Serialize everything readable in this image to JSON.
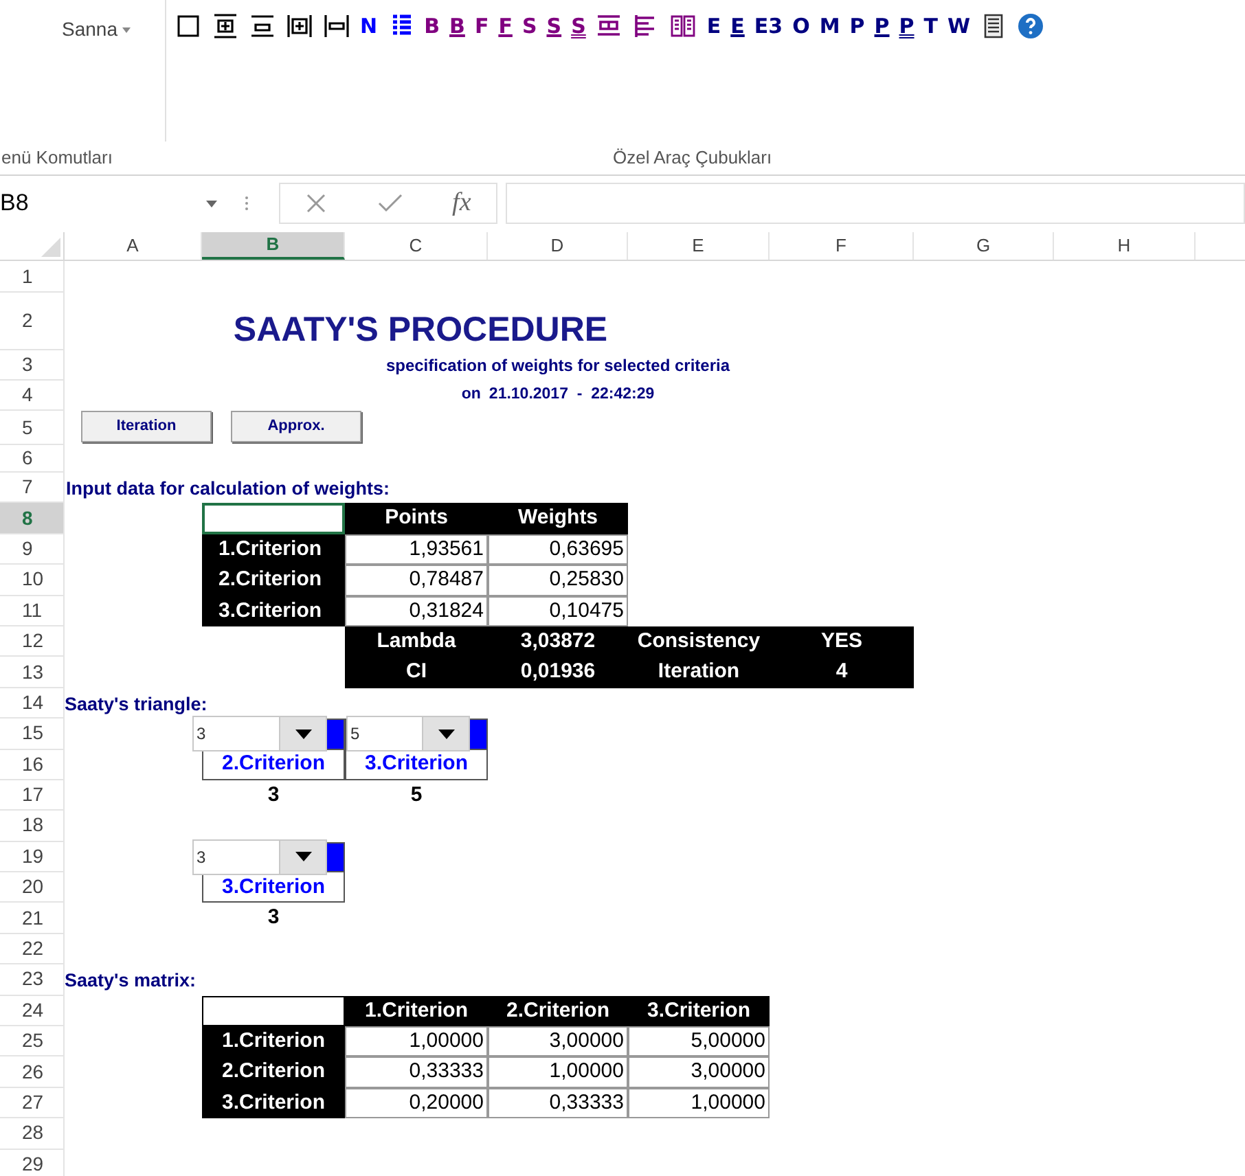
{
  "ribbon": {
    "font_box": "Sanna",
    "toolbar": [
      {
        "kind": "square"
      },
      {
        "kind": "insert-row"
      },
      {
        "kind": "lines"
      },
      {
        "kind": "plus-column"
      },
      {
        "kind": "minus-column"
      },
      {
        "kind": "letter",
        "text": "N",
        "color": "#0000ff"
      },
      {
        "kind": "list"
      },
      {
        "kind": "letter",
        "text": "B",
        "color": "#800080"
      },
      {
        "kind": "underlined",
        "text": "B",
        "color": "#800080"
      },
      {
        "kind": "letter",
        "text": "F",
        "color": "#800080"
      },
      {
        "kind": "underlined",
        "text": "F",
        "color": "#800080"
      },
      {
        "kind": "letter",
        "text": "S",
        "color": "#800080"
      },
      {
        "kind": "underlined",
        "text": "S",
        "color": "#800080"
      },
      {
        "kind": "double",
        "text": "S",
        "color": "#800080"
      },
      {
        "kind": "table"
      },
      {
        "kind": "align"
      },
      {
        "kind": "book"
      },
      {
        "kind": "letter",
        "text": "E",
        "color": "#000080"
      },
      {
        "kind": "underlined",
        "text": "E",
        "color": "#000080"
      },
      {
        "kind": "letter",
        "text": "E3",
        "color": "#000080"
      },
      {
        "kind": "letter",
        "text": "O",
        "color": "#000080"
      },
      {
        "kind": "letter",
        "text": "M",
        "color": "#000080"
      },
      {
        "kind": "letter",
        "text": "P",
        "color": "#000080"
      },
      {
        "kind": "underlined",
        "text": "P",
        "color": "#000080"
      },
      {
        "kind": "double",
        "text": "P",
        "color": "#000080"
      },
      {
        "kind": "letter",
        "text": "T",
        "color": "#000080"
      },
      {
        "kind": "letter",
        "text": "W",
        "color": "#000080"
      },
      {
        "kind": "document"
      },
      {
        "kind": "help"
      }
    ],
    "groups": [
      "enü Komutları",
      "Özel Araç Çubukları"
    ]
  },
  "name_box": "B8",
  "formula_label": "fx",
  "columns": [
    {
      "label": "A",
      "selected": false
    },
    {
      "label": "B",
      "selected": true
    },
    {
      "label": "C",
      "selected": false
    },
    {
      "label": "D",
      "selected": false
    },
    {
      "label": "E",
      "selected": false
    },
    {
      "label": "F",
      "selected": false
    },
    {
      "label": "G",
      "selected": false
    },
    {
      "label": "H",
      "selected": false
    }
  ],
  "rows": [
    {
      "label": "1",
      "selected": false
    },
    {
      "label": "2",
      "selected": false
    },
    {
      "label": "3",
      "selected": false
    },
    {
      "label": "4",
      "selected": false
    },
    {
      "label": "5",
      "selected": false
    },
    {
      "label": "6",
      "selected": false
    },
    {
      "label": "7",
      "selected": false
    },
    {
      "label": "8",
      "selected": true
    },
    {
      "label": "9",
      "selected": false
    },
    {
      "label": "10",
      "selected": false
    },
    {
      "label": "11",
      "selected": false
    },
    {
      "label": "12",
      "selected": false
    },
    {
      "label": "13",
      "selected": false
    },
    {
      "label": "14",
      "selected": false
    },
    {
      "label": "15",
      "selected": false
    },
    {
      "label": "16",
      "selected": false
    },
    {
      "label": "17",
      "selected": false
    },
    {
      "label": "18",
      "selected": false
    },
    {
      "label": "19",
      "selected": false
    },
    {
      "label": "20",
      "selected": false
    },
    {
      "label": "21",
      "selected": false
    },
    {
      "label": "22",
      "selected": false
    },
    {
      "label": "23",
      "selected": false
    },
    {
      "label": "24",
      "selected": false
    },
    {
      "label": "25",
      "selected": false
    },
    {
      "label": "26",
      "selected": false
    },
    {
      "label": "27",
      "selected": false
    },
    {
      "label": "28",
      "selected": false
    },
    {
      "label": "29",
      "selected": false
    }
  ],
  "sheet": {
    "title": "SAATY'S PROCEDURE",
    "subtitle": "specification of weights for selected criteria",
    "date_prefix": "on",
    "date": "21.10.2017  -  22:42:29",
    "buttons": [
      "Iteration",
      "Approx."
    ],
    "input_heading": "Input data for calculation of weights:",
    "weights_table": {
      "columns": [
        "Points",
        "Weights"
      ],
      "rows": [
        {
          "label": "1.Criterion",
          "values": [
            "1,93561",
            "0,63695"
          ]
        },
        {
          "label": "2.Criterion",
          "values": [
            "0,78487",
            "0,25830"
          ]
        },
        {
          "label": "3.Criterion",
          "values": [
            "0,31824",
            "0,10475"
          ]
        }
      ]
    },
    "summary": [
      [
        "Lambda",
        "3,03872",
        "Consistency",
        "YES"
      ],
      [
        "CI",
        "0,01936",
        "Iteration",
        "4"
      ]
    ],
    "triangle_heading": "Saaty's triangle:",
    "triangle": [
      [
        {
          "value": "3",
          "label": "2.Criterion",
          "result": "3"
        },
        {
          "value": "5",
          "label": "3.Criterion",
          "result": "5"
        }
      ],
      [
        {
          "value": "3",
          "label": "3.Criterion",
          "result": "3"
        }
      ]
    ],
    "matrix_heading": "Saaty's matrix:",
    "matrix": {
      "columns": [
        "1.Criterion",
        "2.Criterion",
        "3.Criterion"
      ],
      "rows": [
        {
          "label": "1.Criterion",
          "values": [
            "1,00000",
            "3,00000",
            "5,00000"
          ]
        },
        {
          "label": "2.Criterion",
          "values": [
            "0,33333",
            "1,00000",
            "3,00000"
          ]
        },
        {
          "label": "3.Criterion",
          "values": [
            "0,20000",
            "0,33333",
            "1,00000"
          ]
        }
      ]
    }
  }
}
